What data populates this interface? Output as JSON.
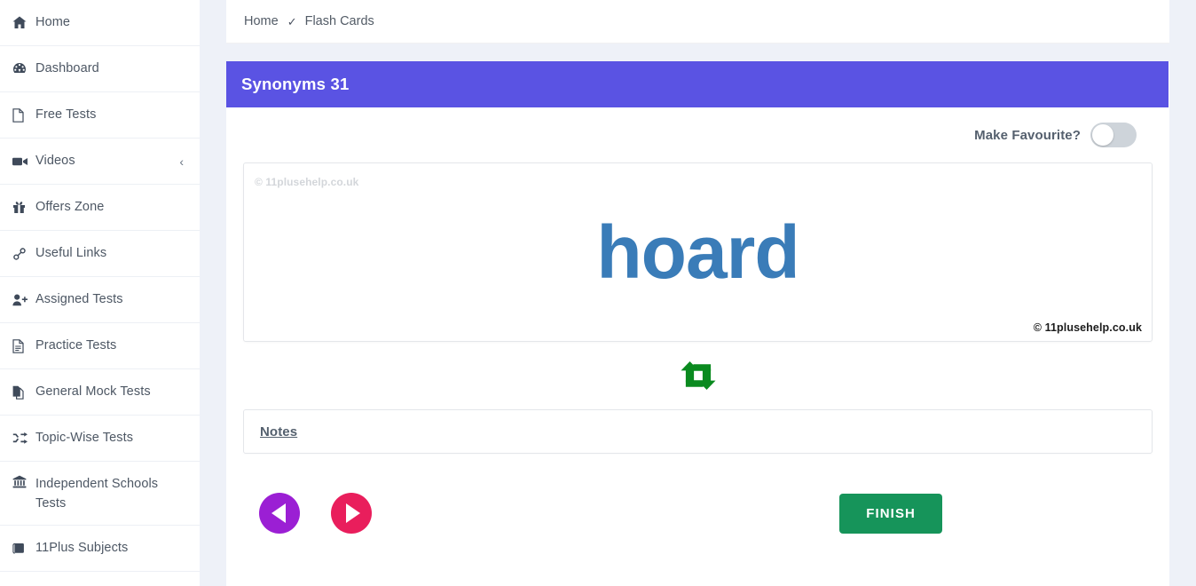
{
  "sidebar": {
    "items": [
      {
        "label": "Home",
        "icon": "home-icon",
        "chevron": ""
      },
      {
        "label": "Dashboard",
        "icon": "dashboard-icon",
        "chevron": ""
      },
      {
        "label": "Free Tests",
        "icon": "file-icon",
        "chevron": ""
      },
      {
        "label": "Videos",
        "icon": "video-camera-icon",
        "chevron": "‹"
      },
      {
        "label": "Offers Zone",
        "icon": "gift-icon",
        "chevron": ""
      },
      {
        "label": "Useful Links",
        "icon": "link-icon",
        "chevron": ""
      },
      {
        "label": "Assigned Tests",
        "icon": "user-plus-icon",
        "chevron": ""
      },
      {
        "label": "Practice Tests",
        "icon": "document-icon",
        "chevron": ""
      },
      {
        "label": "General Mock Tests",
        "icon": "copy-icon",
        "chevron": ""
      },
      {
        "label": "Topic-Wise Tests",
        "icon": "shuffle-icon",
        "chevron": ""
      },
      {
        "label": "Independent Schools Tests",
        "icon": "bank-icon",
        "chevron": ""
      },
      {
        "label": "11Plus Subjects",
        "icon": "book-icon",
        "chevron": ""
      }
    ]
  },
  "breadcrumb": {
    "home": "Home",
    "separator": "✓",
    "current": "Flash Cards"
  },
  "card": {
    "title": "Synonyms 31",
    "favourite_label": "Make Favourite?",
    "favourite_on": false,
    "watermark_top": "© 11plusehelp.co.uk",
    "watermark_bottom": "© 11plusehelp.co.uk",
    "word": "hoard",
    "flip_icon": "retweet-icon",
    "notes_label": "Notes"
  },
  "controls": {
    "prev_icon": "previous-triangle-icon",
    "next_icon": "next-triangle-icon",
    "finish_label": "FINISH"
  },
  "colors": {
    "header_purple": "#5a53e3",
    "word_blue": "#3a7cb8",
    "flip_green": "#0a8a1f",
    "finish_green": "#16945a",
    "prev_purple": "#9b1fd4",
    "next_pink": "#e91e5c",
    "page_bg": "#eef1f8"
  }
}
